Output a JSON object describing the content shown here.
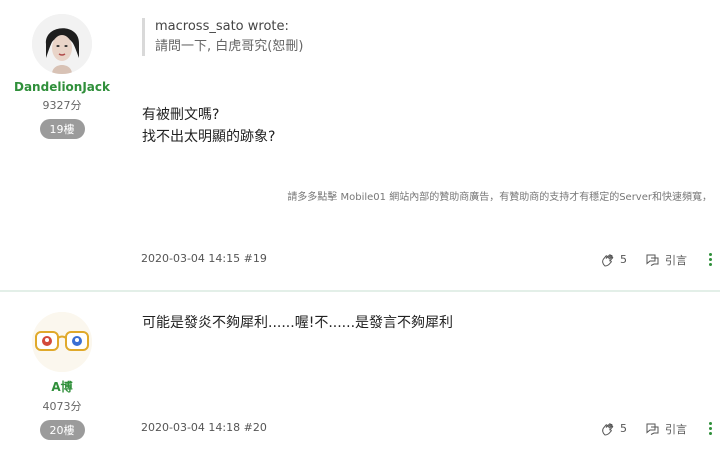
{
  "posts": [
    {
      "author": {
        "name": "DandelionJack",
        "score": "9327分",
        "floor_badge": "19樓",
        "avatar_icon": "user-portrait-icon"
      },
      "quote": {
        "author_line": "macross_sato wrote:",
        "text": "請問一下, 白虎哥究(恕刪)"
      },
      "content_lines": [
        "有被刪文嗎?",
        "找不出太明顯的跡象?"
      ],
      "sponsor_notice": "請多多點擊 Mobile01 網站內部的贊助商廣告，有贊助商的支持才有穩定的Server和快速頻寬，",
      "meta": "2020-03-04 14:15 #19",
      "like_count": "5",
      "quote_label": "引言"
    },
    {
      "author": {
        "name": "A博",
        "score": "4073分",
        "floor_badge": "20樓",
        "avatar_icon": "glasses-avatar-icon"
      },
      "content_lines": [
        "可能是發炎不夠犀利......喔!不......是發言不夠犀利"
      ],
      "meta": "2020-03-04 14:18 #20",
      "like_count": "5",
      "quote_label": "引言"
    }
  ],
  "colors": {
    "accent": "#2f8f3a",
    "badge": "#9b9b9b",
    "divider": "#e3efe8"
  }
}
